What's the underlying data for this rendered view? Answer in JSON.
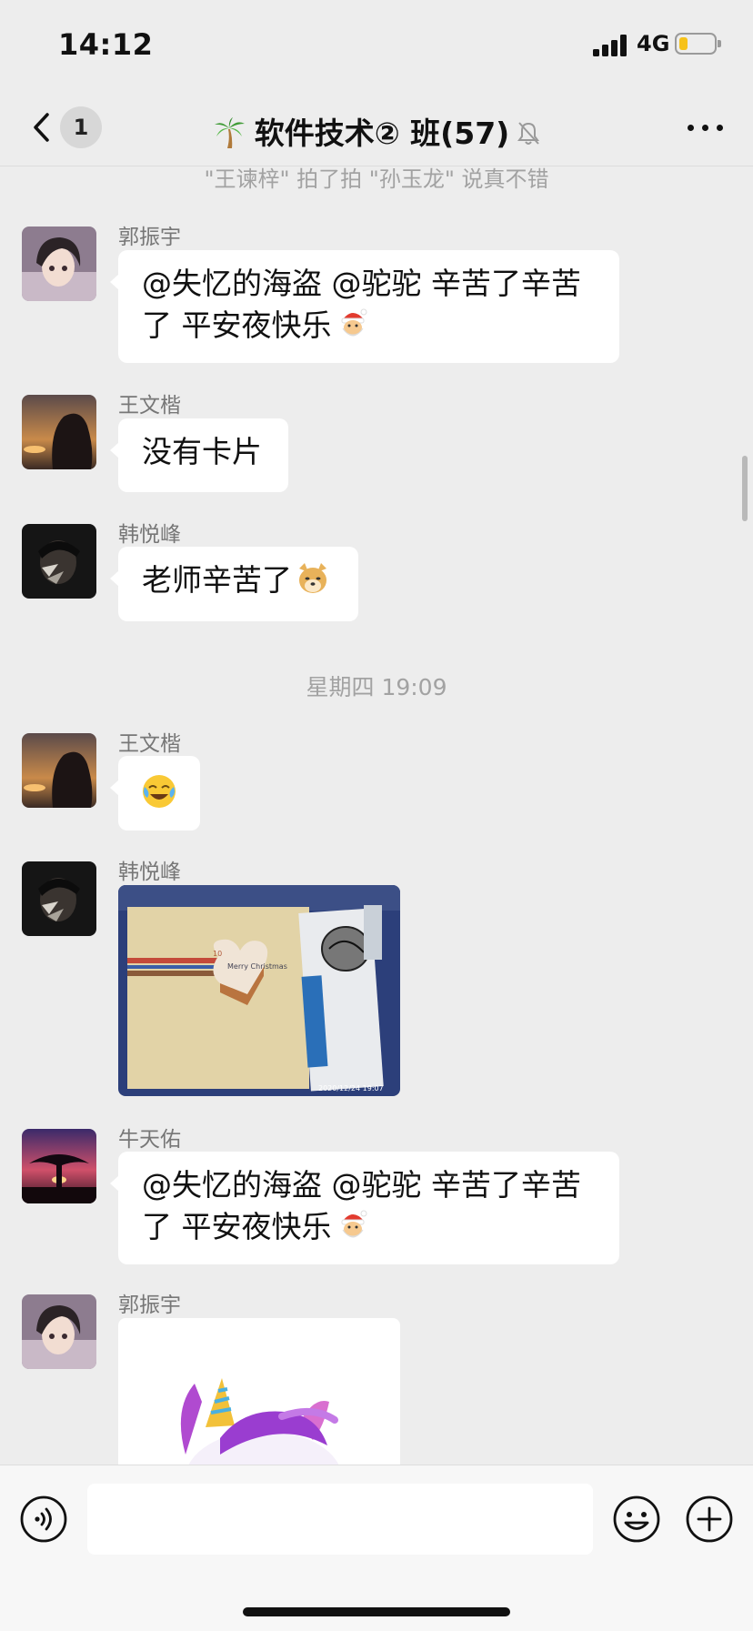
{
  "status_bar": {
    "time": "14:12",
    "network": "4G",
    "battery_level": 0.25
  },
  "nav": {
    "back_badge": "1",
    "title": "软件技术② 班(57)",
    "title_icon": "palm-tree-icon",
    "muted_icon": "bell-off-icon",
    "more_icon": "more-icon"
  },
  "chat": {
    "system_message": "\"王谏梓\" 拍了拍 \"孙玉龙\" 说真不错",
    "messages": [
      {
        "sender": "郭振宇",
        "text": "@失忆的海盗 @驼驼 辛苦了辛苦了 平安夜快乐",
        "emoji": "santa-emoji"
      },
      {
        "sender": "王文楷",
        "text": "没有卡片"
      },
      {
        "sender": "韩悦峰",
        "text": "老师辛苦了",
        "emoji": "doge-emoji"
      },
      {
        "timestamp": "星期四 19:09"
      },
      {
        "sender": "王文楷",
        "emoji": "crying-laughing-emoji"
      },
      {
        "sender": "韩悦峰",
        "image": "photo-card",
        "image_text": {
          "line1": "Merry Christmas",
          "line2": "2020/12/24 19:07"
        }
      },
      {
        "sender": "牛天佑",
        "text": "@失忆的海盗 @驼驼 辛苦了辛苦了 平安夜快乐",
        "emoji": "santa-emoji"
      },
      {
        "sender": "郭振宇",
        "image": "unicorn-sticker"
      }
    ]
  },
  "input_bar": {
    "voice_icon": "voice-icon",
    "emoji_icon": "emoji-icon",
    "plus_icon": "plus-icon",
    "placeholder": ""
  }
}
